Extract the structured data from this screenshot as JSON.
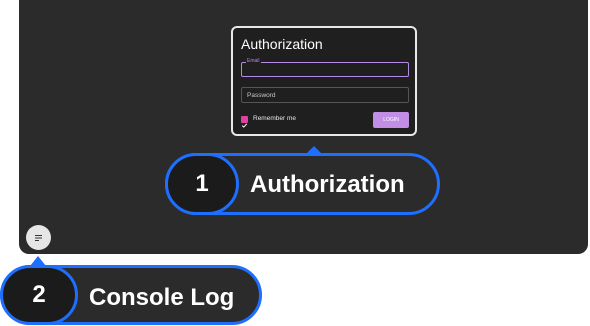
{
  "auth_dialog": {
    "title": "Authorization",
    "email_label": "Email",
    "password_label": "Password",
    "remember_label": "Remember me",
    "remember_checked": true,
    "login_label": "LOGIN",
    "accent": "#b48ae6",
    "button_color": "#c18ee6",
    "check_color": "#e040a0"
  },
  "console_button": {
    "icon": "console-log-icon"
  },
  "callouts": [
    {
      "number": "1",
      "label": "Authorization"
    },
    {
      "number": "2",
      "label": "Console Log"
    }
  ],
  "colors": {
    "canvas": "#2b2b2b",
    "callout_border": "#1f6fff"
  }
}
